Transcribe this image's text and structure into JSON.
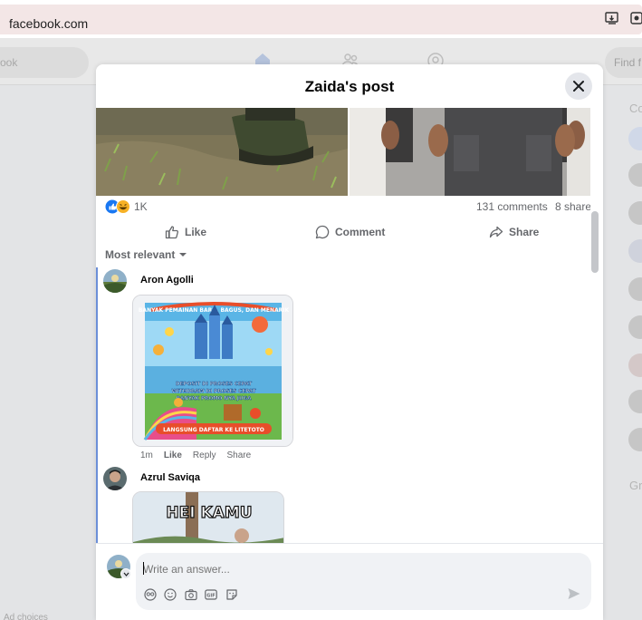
{
  "browser": {
    "url": "facebook.com"
  },
  "background": {
    "search_left_placeholder": "ook",
    "search_right_placeholder": "Find f",
    "right_letters": [
      "Co",
      "Gr"
    ],
    "bottom_text": "Ad choices"
  },
  "modal": {
    "title": "Zaida's post",
    "reactions_count": "1K",
    "comments_count": "131 comments",
    "shares_count": "8 shares",
    "actions": {
      "like": "Like",
      "comment": "Comment",
      "share": "Share"
    },
    "sort_label": "Most relevant",
    "comments": [
      {
        "author": "Aron Agolli",
        "image_banner_top": "BANYAK PEMAINAN BARU, BAGUS, DAN MENARIK",
        "image_text_1": "DEPOSIT DI PROSES CEPAT",
        "image_text_2": "WITHDRAW DI PROSES CEPAT",
        "image_text_3": "BANYAK PROMO NYA JUGA",
        "image_banner_bottom": "LANGSUNG DAFTAR KE LITETOTO",
        "time": "1m",
        "like": "Like",
        "reply": "Reply",
        "share": "Share"
      },
      {
        "author": "Azrul Saviqa",
        "image_text": "HEI KAMU"
      }
    ],
    "composer": {
      "placeholder": "Write an answer..."
    }
  },
  "colors": {
    "like_blue": "#1877f2",
    "haha_yellow": "#f7b125",
    "text_secondary": "#65676b"
  }
}
